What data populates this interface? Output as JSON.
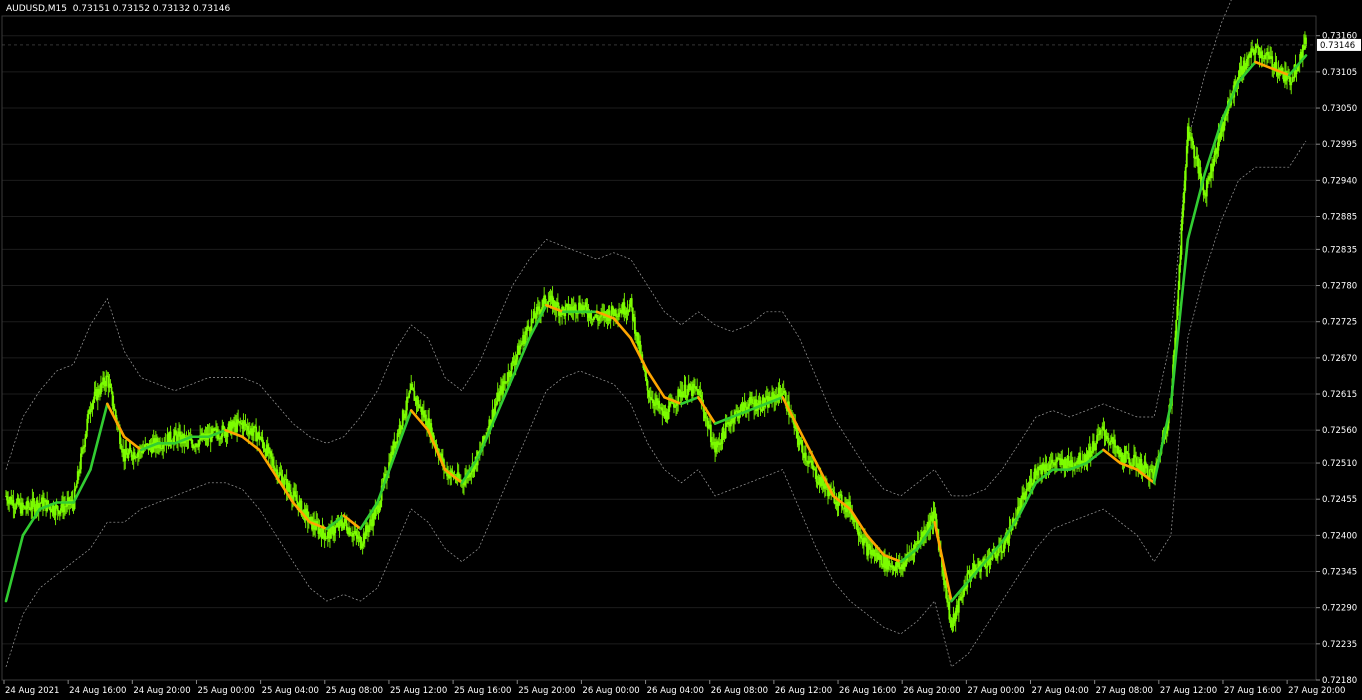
{
  "header": {
    "symbol": "AUDUSD,M15",
    "quote": "0.73151 0.73152 0.73132 0.73146"
  },
  "colors": {
    "background": "#000000",
    "candle": "#7CFC00",
    "ma_up": "#32CD32",
    "ma_down": "#FFA500",
    "band": "#A0A0A0",
    "grid": "#1c1c1c",
    "axis": "#FFFFFF"
  },
  "chart_data": {
    "type": "line",
    "title": "AUDUSD,M15",
    "ylim": [
      0.7218,
      0.7319
    ],
    "y_ticks": [
      "0.73160",
      "0.73105",
      "0.73050",
      "0.72995",
      "0.72940",
      "0.72885",
      "0.72835",
      "0.72780",
      "0.72725",
      "0.72670",
      "0.72615",
      "0.72560",
      "0.72510",
      "0.72455",
      "0.72400",
      "0.72345",
      "0.72290",
      "0.72235",
      "0.72180"
    ],
    "x_ticks": [
      "24 Aug 2021",
      "24 Aug 16:00",
      "24 Aug 20:00",
      "25 Aug 00:00",
      "25 Aug 04:00",
      "25 Aug 08:00",
      "25 Aug 12:00",
      "25 Aug 16:00",
      "25 Aug 20:00",
      "26 Aug 00:00",
      "26 Aug 04:00",
      "26 Aug 08:00",
      "26 Aug 12:00",
      "26 Aug 16:00",
      "26 Aug 20:00",
      "27 Aug 00:00",
      "27 Aug 04:00",
      "27 Aug 08:00",
      "27 Aug 12:00",
      "27 Aug 16:00",
      "27 Aug 20:00"
    ],
    "current_price": "0.73146",
    "grid": true,
    "series": [
      {
        "role": "price",
        "values": [
          0.7246,
          0.7244,
          0.7245,
          0.7244,
          0.7245,
          0.726,
          0.7264,
          0.7252,
          0.7253,
          0.7254,
          0.7255,
          0.7254,
          0.7255,
          0.7256,
          0.7257,
          0.7255,
          0.725,
          0.7246,
          0.7242,
          0.724,
          0.7242,
          0.7239,
          0.7244,
          0.7254,
          0.7262,
          0.7257,
          0.725,
          0.7248,
          0.7252,
          0.726,
          0.7266,
          0.7272,
          0.7276,
          0.7274,
          0.7275,
          0.7273,
          0.7274,
          0.7275,
          0.7262,
          0.7258,
          0.7262,
          0.7262,
          0.7253,
          0.7258,
          0.726,
          0.726,
          0.7262,
          0.7254,
          0.7249,
          0.7246,
          0.7244,
          0.7238,
          0.7236,
          0.7235,
          0.7239,
          0.7243,
          0.7226,
          0.7234,
          0.7236,
          0.7238,
          0.7244,
          0.725,
          0.7251,
          0.7251,
          0.7252,
          0.7256,
          0.7252,
          0.7251,
          0.7249,
          0.726,
          0.7302,
          0.7292,
          0.7302,
          0.731,
          0.7314,
          0.7312,
          0.7309,
          0.7315
        ]
      },
      {
        "role": "moving_average",
        "values": [
          0.723,
          0.724,
          0.7244,
          0.7245,
          0.7245,
          0.725,
          0.726,
          0.7255,
          0.7253,
          0.7254,
          0.7254,
          0.7255,
          0.7255,
          0.7256,
          0.7255,
          0.7253,
          0.7249,
          0.7245,
          0.7242,
          0.7241,
          0.7243,
          0.7241,
          0.7245,
          0.7252,
          0.7259,
          0.7256,
          0.725,
          0.7248,
          0.7252,
          0.7258,
          0.7264,
          0.727,
          0.7275,
          0.7274,
          0.7274,
          0.7274,
          0.7273,
          0.727,
          0.7265,
          0.7261,
          0.726,
          0.7261,
          0.7257,
          0.7258,
          0.7259,
          0.726,
          0.7261,
          0.7256,
          0.7251,
          0.7246,
          0.7244,
          0.724,
          0.7237,
          0.7236,
          0.7238,
          0.7242,
          0.723,
          0.7233,
          0.7236,
          0.7239,
          0.7243,
          0.7248,
          0.725,
          0.725,
          0.7251,
          0.7253,
          0.7251,
          0.725,
          0.7248,
          0.726,
          0.7285,
          0.7295,
          0.7303,
          0.7309,
          0.7312,
          0.7311,
          0.731,
          0.7313
        ]
      },
      {
        "role": "upper_band",
        "values": [
          0.725,
          0.7258,
          0.7262,
          0.7265,
          0.7266,
          0.7272,
          0.7276,
          0.7268,
          0.7264,
          0.7263,
          0.7262,
          0.7263,
          0.7264,
          0.7264,
          0.7264,
          0.7263,
          0.726,
          0.7257,
          0.7255,
          0.7254,
          0.7255,
          0.7258,
          0.7262,
          0.7268,
          0.7272,
          0.727,
          0.7264,
          0.7262,
          0.7266,
          0.7272,
          0.7278,
          0.7282,
          0.7285,
          0.7284,
          0.7283,
          0.7282,
          0.7283,
          0.7282,
          0.7278,
          0.7274,
          0.7272,
          0.7274,
          0.7272,
          0.7271,
          0.7272,
          0.7274,
          0.7274,
          0.727,
          0.7264,
          0.7258,
          0.7254,
          0.725,
          0.7247,
          0.7246,
          0.7248,
          0.725,
          0.7246,
          0.7246,
          0.7247,
          0.725,
          0.7254,
          0.7258,
          0.7259,
          0.7258,
          0.7259,
          0.726,
          0.7259,
          0.7258,
          0.7258,
          0.727,
          0.73,
          0.731,
          0.7318,
          0.7324,
          0.7328,
          0.7326,
          0.7324,
          0.7326
        ]
      },
      {
        "role": "lower_band",
        "values": [
          0.722,
          0.7228,
          0.7232,
          0.7234,
          0.7236,
          0.7238,
          0.7242,
          0.7242,
          0.7244,
          0.7245,
          0.7246,
          0.7247,
          0.7248,
          0.7248,
          0.7247,
          0.7244,
          0.724,
          0.7236,
          0.7232,
          0.723,
          0.7231,
          0.723,
          0.7232,
          0.7238,
          0.7244,
          0.7242,
          0.7238,
          0.7236,
          0.7238,
          0.7244,
          0.725,
          0.7256,
          0.7262,
          0.7264,
          0.7265,
          0.7264,
          0.7263,
          0.726,
          0.7254,
          0.725,
          0.7248,
          0.725,
          0.7246,
          0.7247,
          0.7248,
          0.7249,
          0.725,
          0.7244,
          0.7238,
          0.7233,
          0.723,
          0.7228,
          0.7226,
          0.7225,
          0.7227,
          0.723,
          0.722,
          0.7222,
          0.7226,
          0.723,
          0.7234,
          0.7238,
          0.7241,
          0.7242,
          0.7243,
          0.7244,
          0.7242,
          0.724,
          0.7236,
          0.724,
          0.727,
          0.728,
          0.7288,
          0.7294,
          0.7296,
          0.7296,
          0.7296,
          0.73
        ]
      }
    ]
  }
}
